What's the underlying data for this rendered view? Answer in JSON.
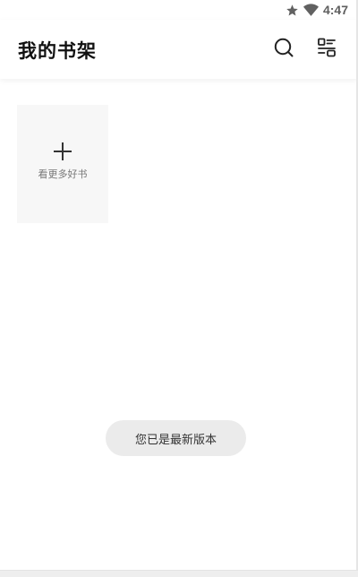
{
  "status_bar": {
    "time": "4:47",
    "icons": [
      "star-icon",
      "wifi-icon"
    ]
  },
  "header": {
    "title": "我的书架",
    "search_icon": "search-icon",
    "manage_icon": "bookshelf-manage-icon"
  },
  "shelf": {
    "add_card_label": "看更多好书",
    "add_icon": "plus-icon"
  },
  "toast": {
    "message": "您已是最新版本"
  },
  "colors": {
    "background": "#ffffff",
    "card_background": "#f7f7f7",
    "toast_background": "#ebebeb",
    "title_text": "#111111"
  }
}
